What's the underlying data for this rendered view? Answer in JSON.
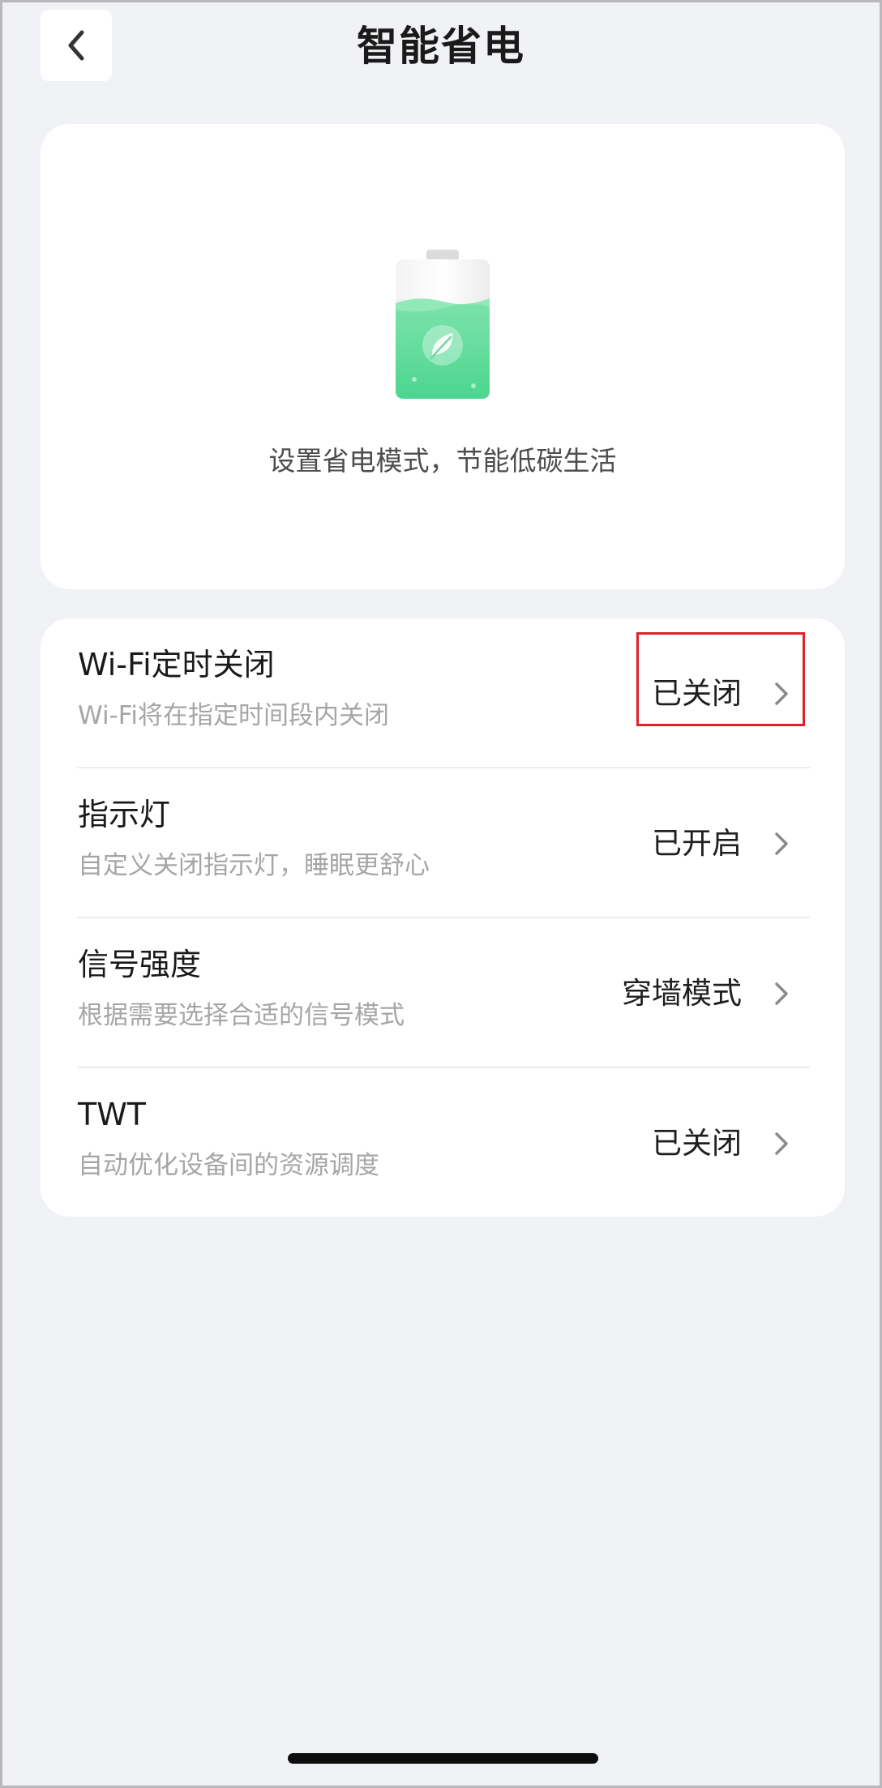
{
  "header": {
    "title": "智能省电",
    "back_icon": "chevron-left-icon"
  },
  "hero": {
    "icon": "battery-leaf-icon",
    "text": "设置省电模式，节能低碳生活",
    "colors": {
      "fill": "#4cd68f",
      "fill_light": "#79e4a8",
      "cap": "#e2e2e2"
    }
  },
  "settings": [
    {
      "title": "Wi-Fi定时关闭",
      "description": "Wi-Fi将在指定时间段内关闭",
      "value": "已关闭"
    },
    {
      "title": "指示灯",
      "description": "自定义关闭指示灯，睡眠更舒心",
      "value": "已开启"
    },
    {
      "title": "信号强度",
      "description": "根据需要选择合适的信号模式",
      "value": "穿墙模式"
    },
    {
      "title": "TWT",
      "description": "自动优化设备间的资源调度",
      "value": "已关闭"
    }
  ],
  "colors": {
    "page_background": "#f1f2f5",
    "card_background": "#ffffff",
    "highlight_border": "#e0202a",
    "description_text": "#a6a6a6"
  }
}
